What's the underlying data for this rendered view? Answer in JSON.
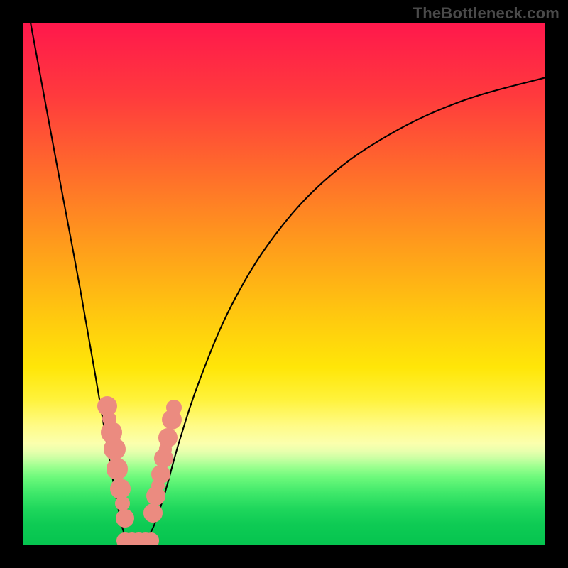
{
  "watermark": "TheBottleneck.com",
  "chart_data": {
    "type": "line",
    "title": "",
    "xlabel": "",
    "ylabel": "",
    "xlim": [
      0,
      100
    ],
    "ylim": [
      0,
      100
    ],
    "curve_left": {
      "name": "left-branch",
      "points": [
        {
          "x": 1.5,
          "y": 100
        },
        {
          "x": 6.5,
          "y": 73
        },
        {
          "x": 11,
          "y": 49
        },
        {
          "x": 14.5,
          "y": 29
        },
        {
          "x": 17,
          "y": 14
        },
        {
          "x": 18.6,
          "y": 5.5
        },
        {
          "x": 19.6,
          "y": 1.8
        },
        {
          "x": 20.8,
          "y": 0.6
        }
      ]
    },
    "curve_right": {
      "name": "right-branch",
      "points": [
        {
          "x": 23.2,
          "y": 0.6
        },
        {
          "x": 25,
          "y": 3.5
        },
        {
          "x": 27.2,
          "y": 10
        },
        {
          "x": 30,
          "y": 20
        },
        {
          "x": 34,
          "y": 32
        },
        {
          "x": 40,
          "y": 46
        },
        {
          "x": 48,
          "y": 59
        },
        {
          "x": 58,
          "y": 70
        },
        {
          "x": 70,
          "y": 78.5
        },
        {
          "x": 84,
          "y": 85
        },
        {
          "x": 100,
          "y": 89.5
        }
      ]
    },
    "markers_left": [
      {
        "x": 16.2,
        "y": 26.6,
        "r": 1.9
      },
      {
        "x": 16.6,
        "y": 24.2,
        "r": 1.35
      },
      {
        "x": 17.0,
        "y": 21.6,
        "r": 2.0
      },
      {
        "x": 17.55,
        "y": 18.4,
        "r": 2.1
      },
      {
        "x": 18.1,
        "y": 14.6,
        "r": 2.05
      },
      {
        "x": 18.7,
        "y": 10.8,
        "r": 2.0
      },
      {
        "x": 19.1,
        "y": 8.0,
        "r": 1.4
      },
      {
        "x": 19.6,
        "y": 5.2,
        "r": 1.75
      }
    ],
    "markers_right": [
      {
        "x": 24.9,
        "y": 6.2,
        "r": 1.8
      },
      {
        "x": 25.5,
        "y": 9.4,
        "r": 1.85
      },
      {
        "x": 25.9,
        "y": 11.4,
        "r": 1.25
      },
      {
        "x": 26.4,
        "y": 13.6,
        "r": 1.8
      },
      {
        "x": 27.0,
        "y": 16.6,
        "r": 1.85
      },
      {
        "x": 27.3,
        "y": 18.4,
        "r": 1.25
      },
      {
        "x": 27.8,
        "y": 20.6,
        "r": 1.8
      },
      {
        "x": 28.5,
        "y": 24.0,
        "r": 1.9
      },
      {
        "x": 29.0,
        "y": 26.4,
        "r": 1.5
      }
    ],
    "markers_bottom": [
      {
        "x": 19.6,
        "y": 0.9,
        "r": 1.6
      },
      {
        "x": 20.9,
        "y": 0.75,
        "r": 1.65
      },
      {
        "x": 22.2,
        "y": 0.75,
        "r": 1.65
      },
      {
        "x": 23.5,
        "y": 0.75,
        "r": 1.65
      },
      {
        "x": 24.6,
        "y": 0.9,
        "r": 1.55
      }
    ]
  }
}
